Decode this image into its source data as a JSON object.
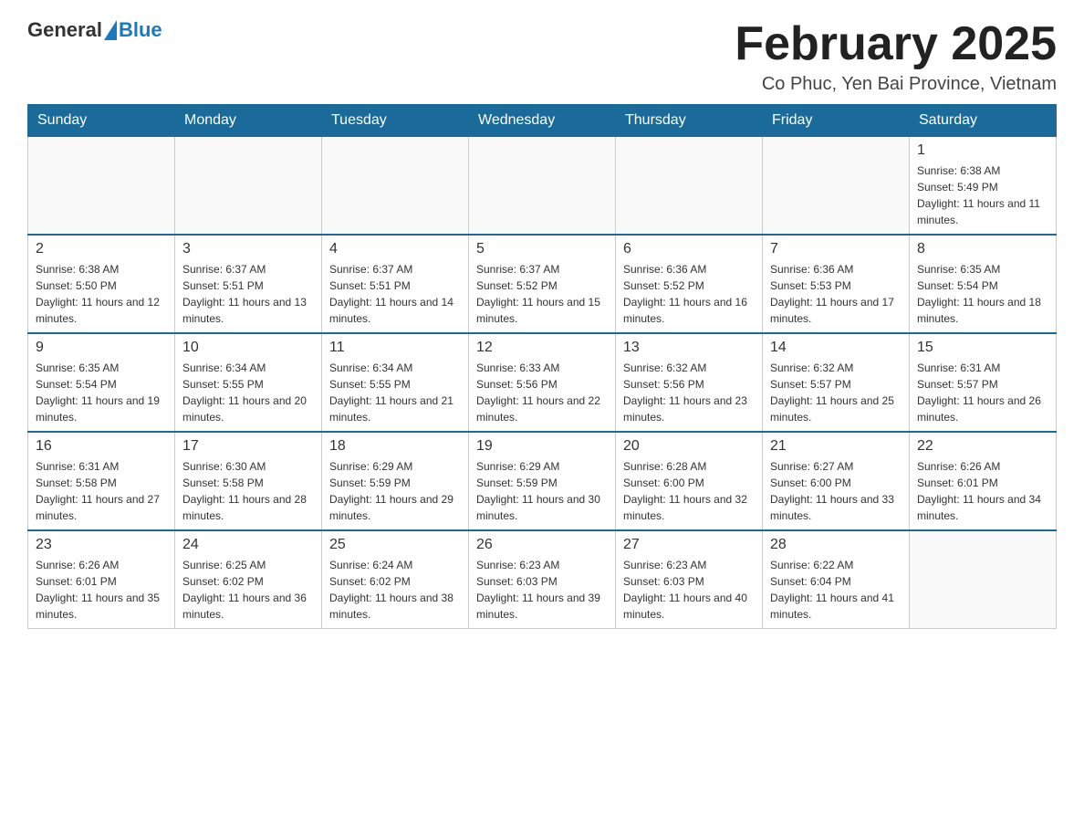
{
  "header": {
    "logo_general": "General",
    "logo_blue": "Blue",
    "title": "February 2025",
    "location": "Co Phuc, Yen Bai Province, Vietnam"
  },
  "days_of_week": [
    "Sunday",
    "Monday",
    "Tuesday",
    "Wednesday",
    "Thursday",
    "Friday",
    "Saturday"
  ],
  "weeks": [
    [
      {
        "day": "",
        "info": ""
      },
      {
        "day": "",
        "info": ""
      },
      {
        "day": "",
        "info": ""
      },
      {
        "day": "",
        "info": ""
      },
      {
        "day": "",
        "info": ""
      },
      {
        "day": "",
        "info": ""
      },
      {
        "day": "1",
        "info": "Sunrise: 6:38 AM\nSunset: 5:49 PM\nDaylight: 11 hours and 11 minutes."
      }
    ],
    [
      {
        "day": "2",
        "info": "Sunrise: 6:38 AM\nSunset: 5:50 PM\nDaylight: 11 hours and 12 minutes."
      },
      {
        "day": "3",
        "info": "Sunrise: 6:37 AM\nSunset: 5:51 PM\nDaylight: 11 hours and 13 minutes."
      },
      {
        "day": "4",
        "info": "Sunrise: 6:37 AM\nSunset: 5:51 PM\nDaylight: 11 hours and 14 minutes."
      },
      {
        "day": "5",
        "info": "Sunrise: 6:37 AM\nSunset: 5:52 PM\nDaylight: 11 hours and 15 minutes."
      },
      {
        "day": "6",
        "info": "Sunrise: 6:36 AM\nSunset: 5:52 PM\nDaylight: 11 hours and 16 minutes."
      },
      {
        "day": "7",
        "info": "Sunrise: 6:36 AM\nSunset: 5:53 PM\nDaylight: 11 hours and 17 minutes."
      },
      {
        "day": "8",
        "info": "Sunrise: 6:35 AM\nSunset: 5:54 PM\nDaylight: 11 hours and 18 minutes."
      }
    ],
    [
      {
        "day": "9",
        "info": "Sunrise: 6:35 AM\nSunset: 5:54 PM\nDaylight: 11 hours and 19 minutes."
      },
      {
        "day": "10",
        "info": "Sunrise: 6:34 AM\nSunset: 5:55 PM\nDaylight: 11 hours and 20 minutes."
      },
      {
        "day": "11",
        "info": "Sunrise: 6:34 AM\nSunset: 5:55 PM\nDaylight: 11 hours and 21 minutes."
      },
      {
        "day": "12",
        "info": "Sunrise: 6:33 AM\nSunset: 5:56 PM\nDaylight: 11 hours and 22 minutes."
      },
      {
        "day": "13",
        "info": "Sunrise: 6:32 AM\nSunset: 5:56 PM\nDaylight: 11 hours and 23 minutes."
      },
      {
        "day": "14",
        "info": "Sunrise: 6:32 AM\nSunset: 5:57 PM\nDaylight: 11 hours and 25 minutes."
      },
      {
        "day": "15",
        "info": "Sunrise: 6:31 AM\nSunset: 5:57 PM\nDaylight: 11 hours and 26 minutes."
      }
    ],
    [
      {
        "day": "16",
        "info": "Sunrise: 6:31 AM\nSunset: 5:58 PM\nDaylight: 11 hours and 27 minutes."
      },
      {
        "day": "17",
        "info": "Sunrise: 6:30 AM\nSunset: 5:58 PM\nDaylight: 11 hours and 28 minutes."
      },
      {
        "day": "18",
        "info": "Sunrise: 6:29 AM\nSunset: 5:59 PM\nDaylight: 11 hours and 29 minutes."
      },
      {
        "day": "19",
        "info": "Sunrise: 6:29 AM\nSunset: 5:59 PM\nDaylight: 11 hours and 30 minutes."
      },
      {
        "day": "20",
        "info": "Sunrise: 6:28 AM\nSunset: 6:00 PM\nDaylight: 11 hours and 32 minutes."
      },
      {
        "day": "21",
        "info": "Sunrise: 6:27 AM\nSunset: 6:00 PM\nDaylight: 11 hours and 33 minutes."
      },
      {
        "day": "22",
        "info": "Sunrise: 6:26 AM\nSunset: 6:01 PM\nDaylight: 11 hours and 34 minutes."
      }
    ],
    [
      {
        "day": "23",
        "info": "Sunrise: 6:26 AM\nSunset: 6:01 PM\nDaylight: 11 hours and 35 minutes."
      },
      {
        "day": "24",
        "info": "Sunrise: 6:25 AM\nSunset: 6:02 PM\nDaylight: 11 hours and 36 minutes."
      },
      {
        "day": "25",
        "info": "Sunrise: 6:24 AM\nSunset: 6:02 PM\nDaylight: 11 hours and 38 minutes."
      },
      {
        "day": "26",
        "info": "Sunrise: 6:23 AM\nSunset: 6:03 PM\nDaylight: 11 hours and 39 minutes."
      },
      {
        "day": "27",
        "info": "Sunrise: 6:23 AM\nSunset: 6:03 PM\nDaylight: 11 hours and 40 minutes."
      },
      {
        "day": "28",
        "info": "Sunrise: 6:22 AM\nSunset: 6:04 PM\nDaylight: 11 hours and 41 minutes."
      },
      {
        "day": "",
        "info": ""
      }
    ]
  ]
}
